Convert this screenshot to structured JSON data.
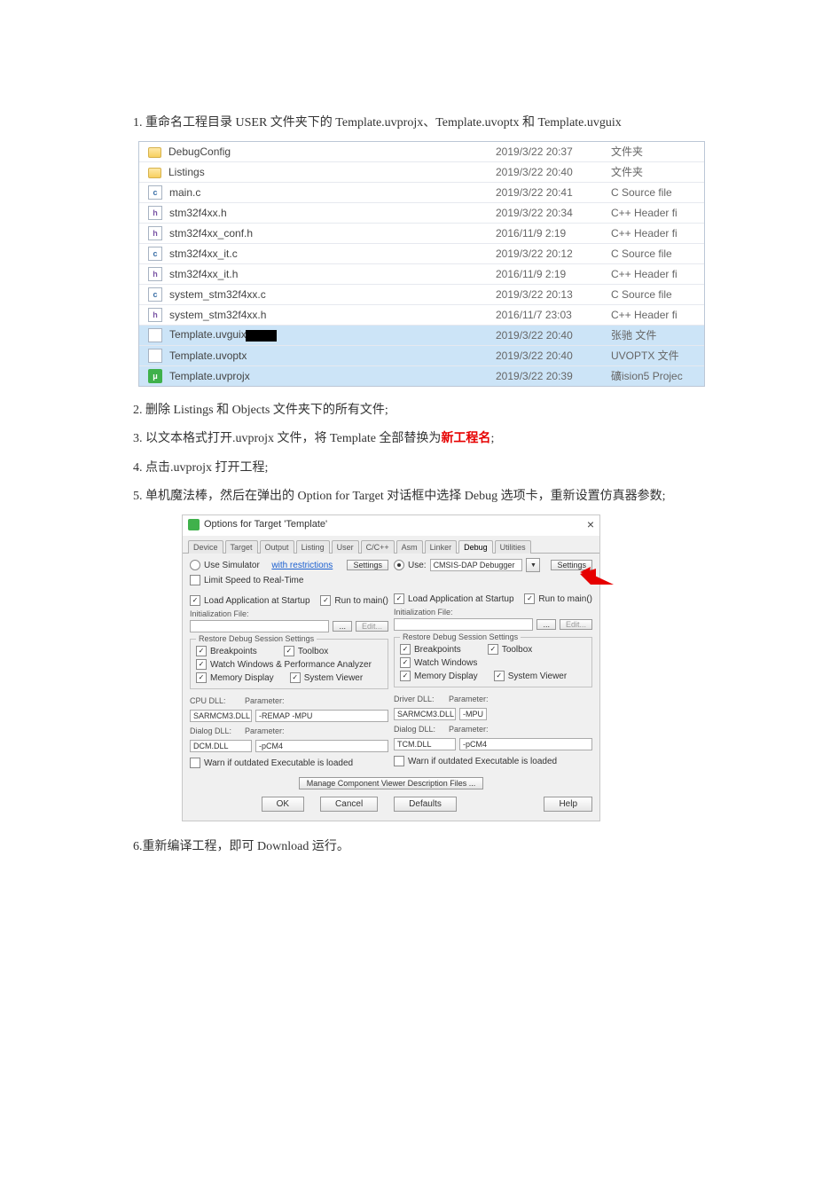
{
  "steps": {
    "s1_pre": "1. 重命名工程目录 USER 文件夹下的 Template.uvprojx、Template.uvoptx 和 Template.uvguix",
    "s2": "2. 删除 Listings 和 Objects 文件夹下的所有文件;",
    "s3_a": "3. 以文本格式打开.uvprojx 文件，将 Template 全部替换为",
    "s3_red": "新工程名",
    "s3_b": ";",
    "s4": "4. 点击.uvprojx 打开工程;",
    "s5": "5. 单机魔法棒，然后在弹出的 Option for Target  对话框中选择 Debug 选项卡，重新设置仿真器参数;",
    "s6": "6.重新编译工程，即可 Download 运行。"
  },
  "files": [
    {
      "icon": "folder",
      "name": "DebugConfig",
      "date": "2019/3/22 20:37",
      "type": "文件夹",
      "sel": false
    },
    {
      "icon": "folder",
      "name": "Listings",
      "date": "2019/3/22 20:40",
      "type": "文件夹",
      "sel": false
    },
    {
      "icon": "c",
      "name": "main.c",
      "date": "2019/3/22 20:41",
      "type": "C Source file",
      "sel": false
    },
    {
      "icon": "h",
      "name": "stm32f4xx.h",
      "date": "2019/3/22 20:34",
      "type": "C++ Header fi",
      "sel": false
    },
    {
      "icon": "h",
      "name": "stm32f4xx_conf.h",
      "date": "2016/11/9 2:19",
      "type": "C++ Header fi",
      "sel": false
    },
    {
      "icon": "c",
      "name": "stm32f4xx_it.c",
      "date": "2019/3/22 20:12",
      "type": "C Source file",
      "sel": false
    },
    {
      "icon": "h",
      "name": "stm32f4xx_it.h",
      "date": "2016/11/9 2:19",
      "type": "C++ Header fi",
      "sel": false
    },
    {
      "icon": "c",
      "name": "system_stm32f4xx.c",
      "date": "2019/3/22 20:13",
      "type": "C Source file",
      "sel": false
    },
    {
      "icon": "h",
      "name": "system_stm32f4xx.h",
      "date": "2016/11/7 23:03",
      "type": "C++ Header fi",
      "sel": false
    },
    {
      "icon": "file",
      "name": "Template.uvguix",
      "date": "2019/3/22 20:40",
      "type": "张驰 文件",
      "sel": true,
      "blackbox": true
    },
    {
      "icon": "file",
      "name": "Template.uvoptx",
      "date": "2019/3/22 20:40",
      "type": "UVOPTX 文件",
      "sel": true
    },
    {
      "icon": "proj",
      "name": "Template.uvprojx",
      "date": "2019/3/22 20:39",
      "type": "礦ision5 Projec",
      "sel": true
    }
  ],
  "dialog": {
    "title": "Options for Target 'Template'",
    "close": "×",
    "tabs": [
      "Device",
      "Target",
      "Output",
      "Listing",
      "User",
      "C/C++",
      "Asm",
      "Linker",
      "Debug",
      "Utilities"
    ],
    "active_tab": 8,
    "left": {
      "use_sim": {
        "label": "Use Simulator",
        "link": "with restrictions",
        "settings": "Settings"
      },
      "limit_speed": "Limit Speed to Real-Time",
      "load_app": "Load Application at Startup",
      "run_to_main": "Run to main()",
      "init_file": "Initialization File:",
      "edit": "Edit...",
      "restore_legend": "Restore Debug Session Settings",
      "breakpoints": "Breakpoints",
      "toolbox": "Toolbox",
      "watch": "Watch Windows & Performance Analyzer",
      "memory": "Memory Display",
      "sysview": "System Viewer",
      "cpu_dll_lbl": "CPU DLL:",
      "param_lbl": "Parameter:",
      "cpu_dll_val": "SARMCM3.DLL",
      "cpu_param_val": "-REMAP -MPU",
      "dialog_dll_lbl": "Dialog DLL:",
      "dialog_dll_val": "DCM.DLL",
      "dialog_param_val": "-pCM4",
      "warn": "Warn if outdated Executable is loaded"
    },
    "right": {
      "use_lbl": "Use:",
      "debugger": "CMSIS-DAP Debugger",
      "settings": "Settings",
      "load_app": "Load Application at Startup",
      "run_to_main": "Run to main()",
      "init_file": "Initialization File:",
      "edit": "Edit...",
      "restore_legend": "Restore Debug Session Settings",
      "breakpoints": "Breakpoints",
      "toolbox": "Toolbox",
      "watch": "Watch Windows",
      "memory": "Memory Display",
      "sysview": "System Viewer",
      "drv_dll_lbl": "Driver DLL:",
      "param_lbl": "Parameter:",
      "drv_dll_val": "SARMCM3.DLL",
      "drv_param_val": "-MPU",
      "dialog_dll_lbl": "Dialog DLL:",
      "dialog_dll_val": "TCM.DLL",
      "dialog_param_val": "-pCM4",
      "warn": "Warn if outdated Executable is loaded"
    },
    "manage_btn": "Manage Component Viewer Description Files ...",
    "footer": {
      "ok": "OK",
      "cancel": "Cancel",
      "defaults": "Defaults",
      "help": "Help"
    }
  }
}
